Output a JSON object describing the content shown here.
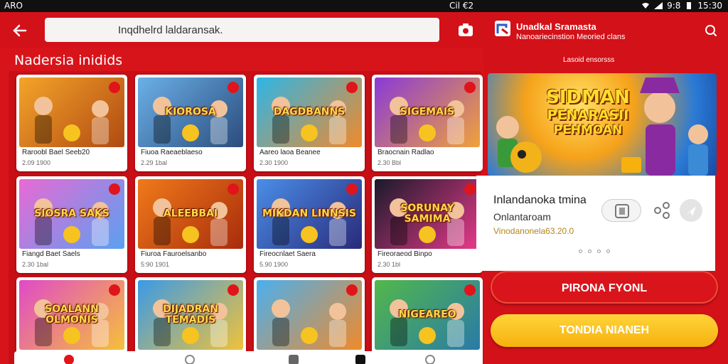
{
  "status_bar": {
    "left": "ARO",
    "middle": "Cil €2",
    "right_time": "15:30",
    "right_extra": "9:8"
  },
  "header": {
    "search_text": "Inqdhelrd laldaransak."
  },
  "section": {
    "title": "Nadersia inidids"
  },
  "games": [
    {
      "title": "Raroobl Bael Seeb20",
      "meta": "2.09 1900",
      "art": "",
      "colors": [
        "#f4a42a",
        "#b04a12"
      ]
    },
    {
      "title": "Fiuoa Raeaeblaeso",
      "meta": "2.29 1bal",
      "art": "KIOROSA",
      "colors": [
        "#6bb0e8",
        "#2b4c7c"
      ]
    },
    {
      "title": "Aareo laoa Beanee",
      "meta": "2.30 1900",
      "art": "DAGDBANNS",
      "colors": [
        "#2cb6e8",
        "#f2892a"
      ]
    },
    {
      "title": "Braocnain Radlao",
      "meta": "2.30 Bbl",
      "art": "SIGEMAIS",
      "colors": [
        "#8a3ad6",
        "#f0a23a"
      ]
    },
    {
      "title": "Fiangd Baet Saels",
      "meta": "2.30 1bal",
      "art": "SIOSRA SAKS",
      "colors": [
        "#e86ad4",
        "#5aa0f0"
      ]
    },
    {
      "title": "Fiuroa Fauroelsanbo",
      "meta": "5:90 1901",
      "art": "ALEEBBAI",
      "colors": [
        "#f07a1a",
        "#a82c0c"
      ]
    },
    {
      "title": "Fireocnlaet Saera",
      "meta": "5.90 1900",
      "art": "MIKDAN LINNSIS",
      "colors": [
        "#4a8ee8",
        "#2a2a7a"
      ]
    },
    {
      "title": "Fireoraeod Binpo",
      "meta": "2.30 1bl",
      "art": "SORUNAY SAMIMA",
      "colors": [
        "#1a1a2a",
        "#e83a8a"
      ]
    },
    {
      "title": "",
      "meta": "",
      "art": "SOALANN OLMONIS",
      "colors": [
        "#e04ac8",
        "#f6c03a"
      ]
    },
    {
      "title": "",
      "meta": "",
      "art": "DIJADRAN TEMADIS",
      "colors": [
        "#3a9ae8",
        "#f0c23a"
      ]
    },
    {
      "title": "",
      "meta": "",
      "art": "",
      "colors": [
        "#4ab0f0",
        "#f08a2a"
      ]
    },
    {
      "title": "",
      "meta": "",
      "art": "NIGEAREO",
      "colors": [
        "#52b84a",
        "#2a7aa8"
      ]
    }
  ],
  "detail": {
    "shop_title": "Unadkal Sramasta",
    "shop_subtitle": "Nanoariecinstion Meoried clans",
    "caption": "Lasoid ensorsss",
    "banner_line1": "SIDMAN",
    "banner_line2": "PENARASII",
    "banner_line3": "PEHMOAN",
    "app_name": "Inlandanoka tmina",
    "developer": "Onlantaroam",
    "price": "Vinodanonela63.20.0",
    "primary_button": "PIRONA FYONL",
    "secondary_button": "TONDIA NIANEH"
  },
  "colors": {
    "brand_red": "#d31118",
    "accent_yellow": "#f6b10e"
  },
  "icons": [
    "back-arrow-icon",
    "camera-icon",
    "shop-icon",
    "search-icon",
    "share-icon",
    "send-icon",
    "bookmark-icon"
  ]
}
